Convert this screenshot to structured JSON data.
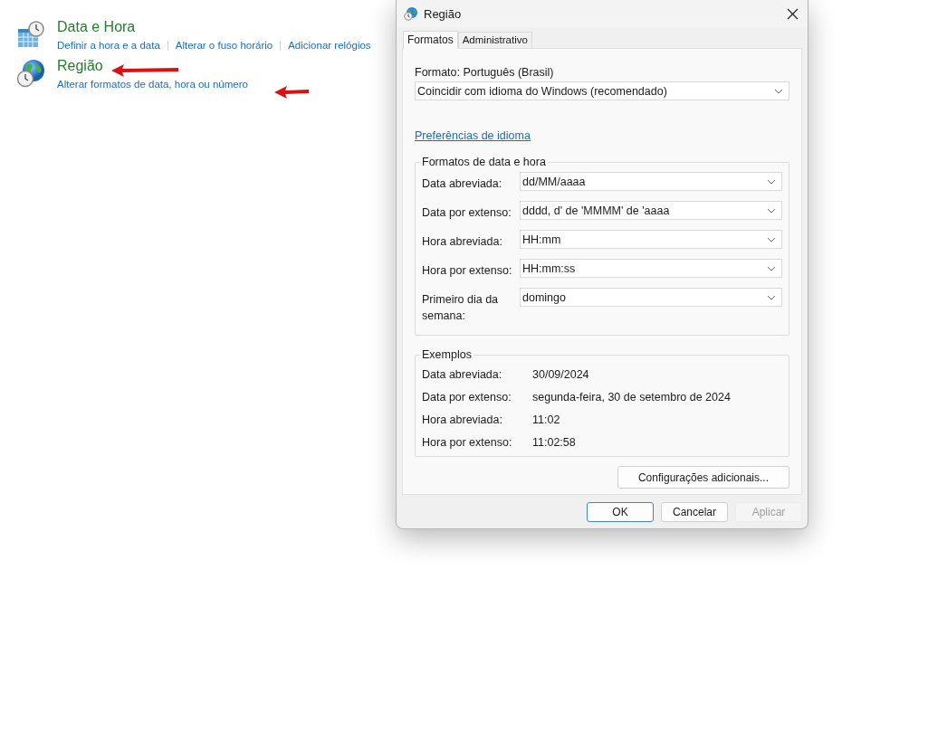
{
  "control_panel": {
    "items": [
      {
        "title": "Data e Hora",
        "links": [
          "Definir a hora e a data",
          "Alterar o fuso horário",
          "Adicionar relógios"
        ]
      },
      {
        "title": "Região",
        "links": [
          "Alterar formatos de data, hora ou número"
        ]
      }
    ]
  },
  "annotations": [
    {
      "kind": "arrow"
    },
    {
      "kind": "arrow"
    }
  ],
  "dialog": {
    "title": "Região",
    "tabs": [
      {
        "label": "Formatos",
        "selected": true
      },
      {
        "label": "Administrativo",
        "selected": false
      }
    ],
    "format_label": "Formato: Português (Brasil)",
    "format_dropdown": {
      "value": "Coincidir com idioma do Windows (recomendado)"
    },
    "language_link": "Preferências de idioma",
    "formats_group": {
      "title": "Formatos de data e hora",
      "fields": [
        {
          "label": "Data abreviada:",
          "value": "dd/MM/aaaa"
        },
        {
          "label": "Data por extenso:",
          "value": "dddd, d' de 'MMMM' de 'aaaa"
        },
        {
          "label": "Hora abreviada:",
          "value": "HH:mm"
        },
        {
          "label": "Hora por extenso:",
          "value": "HH:mm:ss"
        },
        {
          "label": "Primeiro dia da semana:",
          "value": "domingo"
        }
      ]
    },
    "examples_group": {
      "title": "Exemplos",
      "rows": [
        {
          "label": "Data abreviada:",
          "value": "30/09/2024"
        },
        {
          "label": "Data por extenso:",
          "value": "segunda-feira, 30 de setembro de 2024"
        },
        {
          "label": "Hora abreviada:",
          "value": "11:02"
        },
        {
          "label": "Hora por extenso:",
          "value": "11:02:58"
        }
      ]
    },
    "additional_button": "Configurações adicionais...",
    "buttons": [
      {
        "label": "OK",
        "default": true,
        "disabled": false
      },
      {
        "label": "Cancelar",
        "default": false,
        "disabled": false
      },
      {
        "label": "Aplicar",
        "default": false,
        "disabled": true
      }
    ]
  }
}
